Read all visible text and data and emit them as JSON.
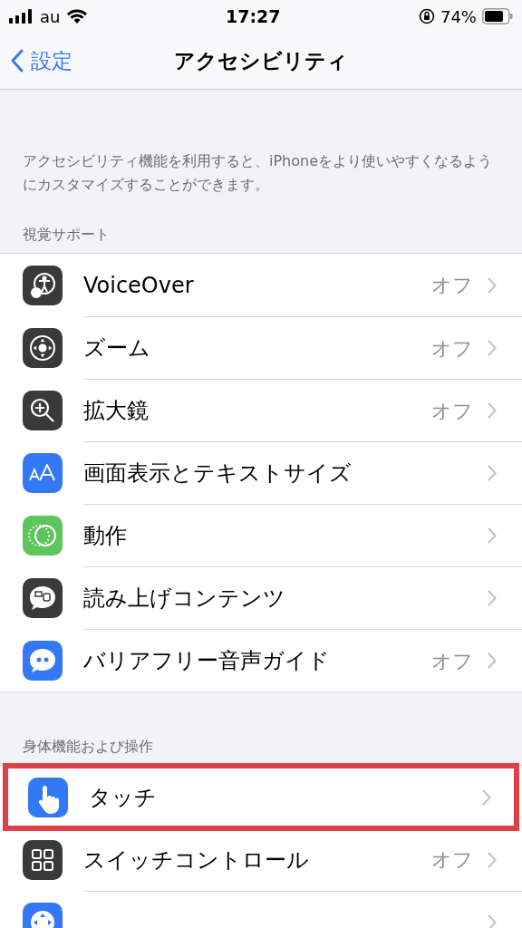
{
  "status_bar": {
    "carrier": "au",
    "time": "17:27",
    "battery": "74%"
  },
  "nav": {
    "back": "設定",
    "title": "アクセシビリティ"
  },
  "description": "アクセシビリティ機能を利用すると、iPhoneをより使いやすくなるようにカスタマイズすることができます。",
  "sections": [
    {
      "header": "視覚サポート",
      "rows": [
        {
          "label": "VoiceOver",
          "value": "オフ",
          "highlighted": false
        },
        {
          "label": "ズーム",
          "value": "オフ",
          "highlighted": false
        },
        {
          "label": "拡大鏡",
          "value": "オフ",
          "highlighted": false
        },
        {
          "label": "画面表示とテキストサイズ",
          "highlighted": false
        },
        {
          "label": "動作",
          "highlighted": false
        },
        {
          "label": "読み上げコンテンツ",
          "highlighted": false
        },
        {
          "label": "バリアフリー音声ガイド",
          "value": "オフ",
          "highlighted": false
        }
      ]
    },
    {
      "header": "身体機能および操作",
      "rows": [
        {
          "label": "タッチ",
          "highlighted": true
        },
        {
          "label": "スイッチコントロール",
          "value": "オフ",
          "highlighted": false
        },
        {
          "highlighted": false
        }
      ]
    }
  ]
}
